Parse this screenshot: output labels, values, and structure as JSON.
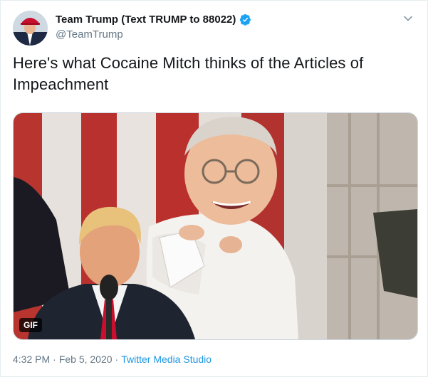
{
  "user": {
    "display_name": "Team Trump (Text TRUMP to 88022)",
    "handle": "@TeamTrump",
    "verified": true
  },
  "tweet": {
    "text": "Here's what Cocaine Mitch thinks of the Articles of Impeachment"
  },
  "media": {
    "badge": "GIF"
  },
  "meta": {
    "time": "4:32 PM",
    "separator": "·",
    "date": "Feb 5, 2020",
    "source": "Twitter Media Studio"
  },
  "colors": {
    "link": "#1b95e0",
    "verified": "#1da1f2",
    "secondary_text": "#657786"
  },
  "icons": {
    "verified": "verified-badge-icon",
    "menu": "chevron-down-icon"
  }
}
